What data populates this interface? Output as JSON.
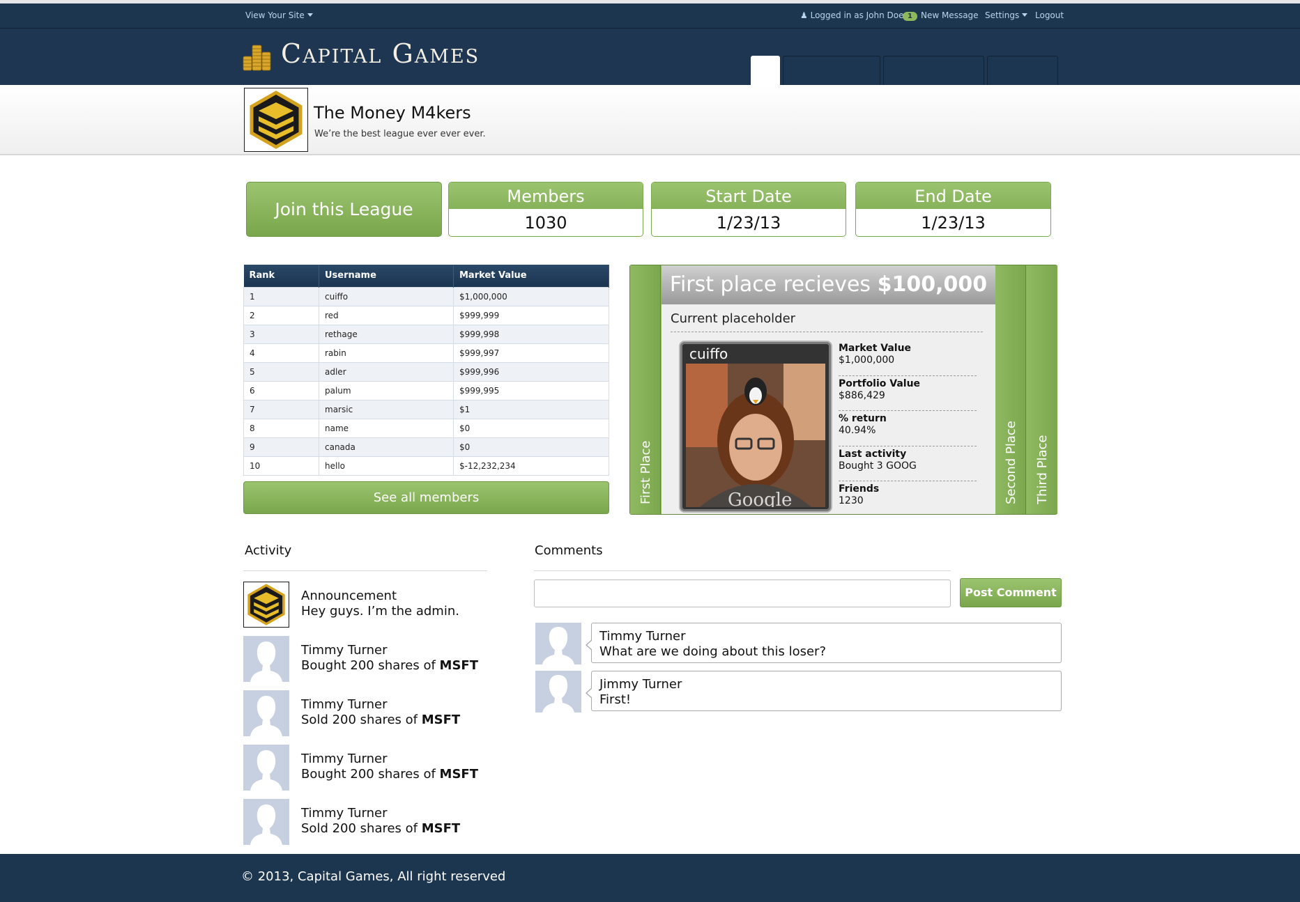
{
  "topbar": {
    "view_site": "View Your Site",
    "logged_in": "Logged in as John Doe",
    "message_count": "1",
    "new_message": "New Message",
    "settings": "Settings",
    "logout": "Logout"
  },
  "brand": {
    "name": "Capital Games"
  },
  "league": {
    "title": "The Money M4kers",
    "subtitle": "We’re the best league ever ever ever."
  },
  "actions": {
    "join_label": "Join this League"
  },
  "stats": {
    "members_label": "Members",
    "members_value": "1030",
    "start_label": "Start Date",
    "start_value": "1/23/13",
    "end_label": "End Date",
    "end_value": "1/23/13"
  },
  "leaderboard": {
    "columns": [
      "Rank",
      "Username",
      "Market Value"
    ],
    "rows": [
      [
        "1",
        "cuiffo",
        "$1,000,000"
      ],
      [
        "2",
        "red",
        "$999,999"
      ],
      [
        "3",
        "rethage",
        "$999,998"
      ],
      [
        "4",
        "rabin",
        "$999,997"
      ],
      [
        "5",
        "adler",
        "$999,996"
      ],
      [
        "6",
        "palum",
        "$999,995"
      ],
      [
        "7",
        "marsic",
        "$1"
      ],
      [
        "8",
        "name",
        "$0"
      ],
      [
        "9",
        "canada",
        "$0"
      ],
      [
        "10",
        "hello",
        "$-12,232,234"
      ]
    ],
    "see_all_label": "See all members"
  },
  "places": {
    "prize_prefix": "First place recieves",
    "prize_amount": "$100,000",
    "first_tab": "First Place",
    "second_tab": "Second Place",
    "third_tab": "Third Place",
    "placeholder_label": "Current placeholder",
    "username": "cuiffo",
    "stats": [
      {
        "label": "Market Value",
        "value": "$1,000,000"
      },
      {
        "label": "Portfolio Value",
        "value": "$886,429"
      },
      {
        "label": "% return",
        "value": "40.94%"
      },
      {
        "label": "Last activity",
        "value": "Bought 3 GOOG"
      },
      {
        "label": "Friends",
        "value": "1230"
      }
    ]
  },
  "activity": {
    "title": "Activity",
    "items": [
      {
        "title": "Announcement",
        "text": "Hey guys. I’m the admin.",
        "ticker": ""
      },
      {
        "title": "Timmy Turner",
        "text": "Bought 200 shares of ",
        "ticker": "MSFT"
      },
      {
        "title": "Timmy Turner",
        "text": "Sold 200 shares of ",
        "ticker": "MSFT"
      },
      {
        "title": "Timmy Turner",
        "text": "Bought 200 shares of ",
        "ticker": "MSFT"
      },
      {
        "title": "Timmy Turner",
        "text": "Sold 200 shares of ",
        "ticker": "MSFT"
      }
    ]
  },
  "comments": {
    "title": "Comments",
    "input_value": "",
    "post_label": "Post Comment",
    "items": [
      {
        "author": "Timmy Turner",
        "text": "What are we doing about this loser?"
      },
      {
        "author": "Jimmy Turner",
        "text": "First!"
      }
    ]
  },
  "footer": {
    "text": "© 2013,  Capital Games, All right reserved"
  },
  "colors": {
    "navy": "#1d3650",
    "green": "#8db661",
    "link": "#b9d6ee"
  }
}
